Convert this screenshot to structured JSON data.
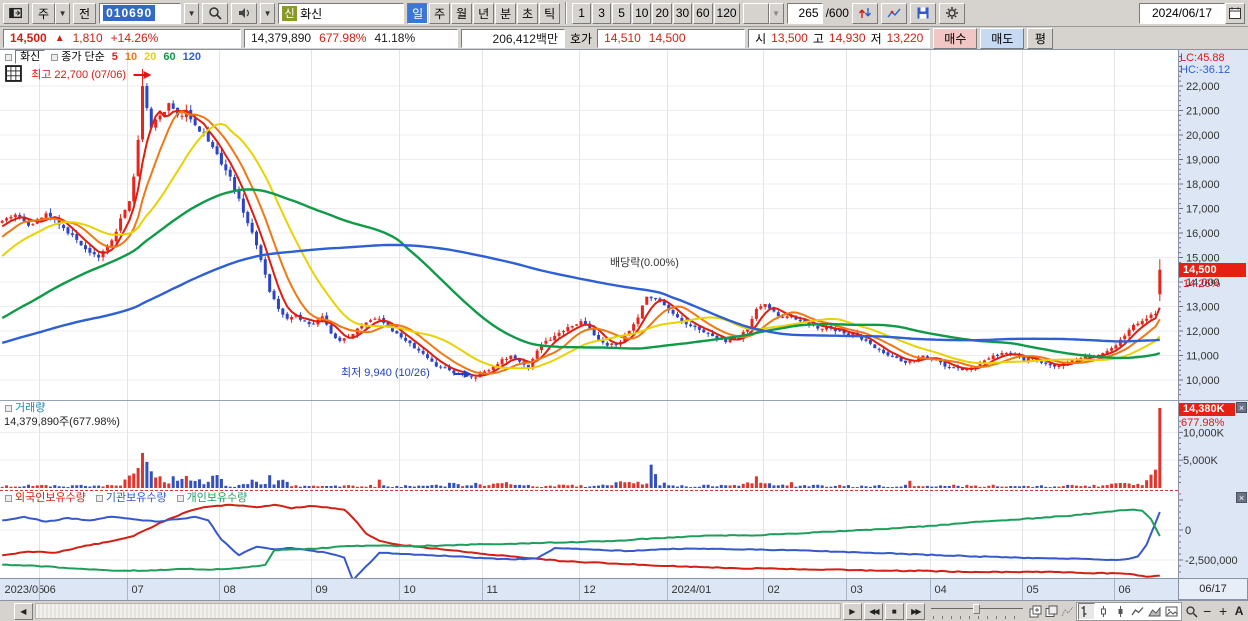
{
  "toolbar": {
    "combo1": "주",
    "prev_btn": "전",
    "code": "010690",
    "stock_badge": "신",
    "stock_name": "화신",
    "periods": [
      "일",
      "주",
      "월",
      "년",
      "분",
      "초",
      "틱"
    ],
    "active_period": "일",
    "minutes": [
      "1",
      "3",
      "5",
      "10",
      "20",
      "30",
      "60",
      "120"
    ],
    "bar_count": "265",
    "bar_total": "/600",
    "date": "2024/06/17"
  },
  "info": {
    "price": "14,500",
    "arrow": "▲",
    "change": "1,810",
    "change_pct": "+14.26%",
    "volume": "14,379,890",
    "vol_rate": "677.98%",
    "turnover": "41.18%",
    "value": "206,412백만",
    "hoga_label": "호가",
    "ask": "14,510",
    "bid": "14,500",
    "open_label": "시",
    "open": "13,500",
    "high_label": "고",
    "high": "14,930",
    "low_label": "저",
    "low": "13,220",
    "buy_btn": "매수",
    "sell_btn": "매도",
    "avg_btn": "평"
  },
  "bottom": {
    "font_label": "A"
  },
  "chart_data": {
    "type": "candlestick",
    "symbol": "화신",
    "code": "010690",
    "timeframe": "일",
    "bars_visible": 265,
    "legend_title": "화신",
    "legend_ma": "종가 단순",
    "lc_label": "LC:45.88",
    "hc_label": "HC:-36.12",
    "price_axis": {
      "min": 10000,
      "max": 22000,
      "step": 1000
    },
    "current_price_label": "14,500",
    "current_pct": "14.26%",
    "last_bar": {
      "open": 13500,
      "high": 14930,
      "low": 13220,
      "close": 14500,
      "volume_k": 14380
    },
    "high_marker": {
      "text": "최고 22,700 (07/06)",
      "index": 32,
      "price": 22700
    },
    "low_marker": {
      "text": "최저 9,940 (10/26)",
      "index": 108,
      "price": 9940
    },
    "event_marker": {
      "text": "배당락(0.00%)",
      "index": 148
    },
    "x_axis_end_label": "06/17",
    "month_starts": [
      {
        "label": "2023/05",
        "i": 0
      },
      {
        "label": "06",
        "i": 9
      },
      {
        "label": "07",
        "i": 29
      },
      {
        "label": "08",
        "i": 50
      },
      {
        "label": "09",
        "i": 71
      },
      {
        "label": "10",
        "i": 91
      },
      {
        "label": "11",
        "i": 110
      },
      {
        "label": "12",
        "i": 132
      },
      {
        "label": "2024/01",
        "i": 152
      },
      {
        "label": "02",
        "i": 174
      },
      {
        "label": "03",
        "i": 193
      },
      {
        "label": "04",
        "i": 212
      },
      {
        "label": "05",
        "i": 233
      },
      {
        "label": "06",
        "i": 254
      }
    ],
    "close_anchors": [
      [
        0,
        16500
      ],
      [
        3,
        16750
      ],
      [
        6,
        16300
      ],
      [
        10,
        16800
      ],
      [
        14,
        16200
      ],
      [
        18,
        15500
      ],
      [
        22,
        15000
      ],
      [
        25,
        15700
      ],
      [
        27,
        16600
      ],
      [
        29,
        17300
      ],
      [
        30,
        18300
      ],
      [
        31,
        19800
      ],
      [
        32,
        22000
      ],
      [
        33,
        21100
      ],
      [
        34,
        20300
      ],
      [
        36,
        20800
      ],
      [
        38,
        21300
      ],
      [
        40,
        20800
      ],
      [
        42,
        21000
      ],
      [
        44,
        20400
      ],
      [
        46,
        20100
      ],
      [
        48,
        19500
      ],
      [
        50,
        18800
      ],
      [
        52,
        18300
      ],
      [
        54,
        17400
      ],
      [
        56,
        16400
      ],
      [
        58,
        15500
      ],
      [
        60,
        14300
      ],
      [
        61,
        13600
      ],
      [
        63,
        12900
      ],
      [
        65,
        12500
      ],
      [
        67,
        12650
      ],
      [
        69,
        12400
      ],
      [
        71,
        12300
      ],
      [
        73,
        12600
      ],
      [
        75,
        11900
      ],
      [
        77,
        11600
      ],
      [
        79,
        11750
      ],
      [
        81,
        12100
      ],
      [
        83,
        12350
      ],
      [
        86,
        12500
      ],
      [
        88,
        12150
      ],
      [
        90,
        11900
      ],
      [
        93,
        11500
      ],
      [
        95,
        11200
      ],
      [
        97,
        10900
      ],
      [
        99,
        10550
      ],
      [
        102,
        10400
      ],
      [
        104,
        10250
      ],
      [
        106,
        10150
      ],
      [
        108,
        10100
      ],
      [
        110,
        10350
      ],
      [
        112,
        10550
      ],
      [
        114,
        10850
      ],
      [
        116,
        11000
      ],
      [
        118,
        10750
      ],
      [
        120,
        10500
      ],
      [
        122,
        11200
      ],
      [
        124,
        11600
      ],
      [
        126,
        11800
      ],
      [
        128,
        12000
      ],
      [
        130,
        12200
      ],
      [
        132,
        12400
      ],
      [
        134,
        12100
      ],
      [
        136,
        11650
      ],
      [
        138,
        11400
      ],
      [
        141,
        11550
      ],
      [
        143,
        12000
      ],
      [
        145,
        12550
      ],
      [
        147,
        13400
      ],
      [
        149,
        13300
      ],
      [
        151,
        13050
      ],
      [
        153,
        12700
      ],
      [
        155,
        12400
      ],
      [
        157,
        12200
      ],
      [
        159,
        12050
      ],
      [
        161,
        11900
      ],
      [
        163,
        11700
      ],
      [
        165,
        11550
      ],
      [
        168,
        11700
      ],
      [
        170,
        12100
      ],
      [
        172,
        12900
      ],
      [
        174,
        13100
      ],
      [
        176,
        12800
      ],
      [
        178,
        12550
      ],
      [
        180,
        12600
      ],
      [
        182,
        12400
      ],
      [
        184,
        12250
      ],
      [
        186,
        12100
      ],
      [
        188,
        12200
      ],
      [
        190,
        12000
      ],
      [
        192,
        11900
      ],
      [
        195,
        11800
      ],
      [
        197,
        11600
      ],
      [
        199,
        11300
      ],
      [
        201,
        11100
      ],
      [
        204,
        10900
      ],
      [
        206,
        10700
      ],
      [
        208,
        10800
      ],
      [
        210,
        11000
      ],
      [
        213,
        10800
      ],
      [
        215,
        10550
      ],
      [
        217,
        10500
      ],
      [
        219,
        10400
      ],
      [
        222,
        10550
      ],
      [
        224,
        10800
      ],
      [
        226,
        11000
      ],
      [
        228,
        11100
      ],
      [
        231,
        11000
      ],
      [
        233,
        10800
      ],
      [
        235,
        10900
      ],
      [
        237,
        10700
      ],
      [
        240,
        10550
      ],
      [
        242,
        10700
      ],
      [
        244,
        10800
      ],
      [
        246,
        10900
      ],
      [
        249,
        11000
      ],
      [
        251,
        11100
      ],
      [
        253,
        11300
      ],
      [
        255,
        11650
      ],
      [
        257,
        12050
      ],
      [
        259,
        12300
      ],
      [
        261,
        12500
      ],
      [
        263,
        12690
      ],
      [
        264,
        14500
      ]
    ],
    "noise": 0.012,
    "ma_series": [
      {
        "period": 5,
        "color": "#e11d10"
      },
      {
        "period": 10,
        "color": "#f07814"
      },
      {
        "period": 20,
        "color": "#e8d200"
      },
      {
        "period": 60,
        "color": "#0f9a48"
      },
      {
        "period": 120,
        "color": "#2e5fd4"
      }
    ],
    "volume": {
      "legend": "거래량",
      "detail": "14,379,890주(677.98%)",
      "current_label": "14,380K",
      "current_pct": "677.98%",
      "ticks": [
        {
          "label": "10,000K",
          "v": 10000
        },
        {
          "label": "5,000K",
          "v": 5000
        }
      ],
      "spikes": [
        [
          30,
          2600
        ],
        [
          31,
          3600
        ],
        [
          32,
          6300
        ],
        [
          33,
          4700
        ],
        [
          34,
          3000
        ],
        [
          48,
          2200
        ],
        [
          61,
          2300
        ],
        [
          86,
          1500
        ],
        [
          148,
          4200
        ],
        [
          149,
          2500
        ],
        [
          172,
          2100
        ],
        [
          207,
          1300
        ],
        [
          255,
          900
        ],
        [
          261,
          1400
        ],
        [
          262,
          2400
        ],
        [
          263,
          3300
        ],
        [
          264,
          14380
        ]
      ],
      "regions": [
        [
          28,
          50,
          4
        ],
        [
          55,
          65,
          2.5
        ],
        [
          100,
          116,
          1.8
        ],
        [
          140,
          152,
          2
        ],
        [
          166,
          180,
          1.8
        ],
        [
          253,
          263,
          2
        ]
      ]
    },
    "holdings": {
      "series": [
        {
          "name": "외국인보유수량",
          "color": "#d22014",
          "anchors": [
            [
              0,
              -2.1
            ],
            [
              6,
              -1.8
            ],
            [
              12,
              -1.9
            ],
            [
              18,
              -1.4
            ],
            [
              24,
              -1.0
            ],
            [
              30,
              -0.5
            ],
            [
              36,
              0.6
            ],
            [
              42,
              1.5
            ],
            [
              46,
              1.9
            ],
            [
              52,
              2.1
            ],
            [
              58,
              1.9
            ],
            [
              62,
              2.1
            ],
            [
              66,
              1.8
            ],
            [
              70,
              2.0
            ],
            [
              74,
              1.9
            ],
            [
              78,
              1.7
            ],
            [
              80,
              1.0
            ],
            [
              83,
              -0.3
            ],
            [
              86,
              -0.9
            ],
            [
              90,
              -1.2
            ],
            [
              95,
              -1.4
            ],
            [
              100,
              -1.6
            ],
            [
              105,
              -1.8
            ],
            [
              110,
              -2.0
            ],
            [
              116,
              -2.2
            ],
            [
              122,
              -2.4
            ],
            [
              128,
              -2.6
            ],
            [
              134,
              -2.7
            ],
            [
              140,
              -2.8
            ],
            [
              146,
              -2.9
            ],
            [
              152,
              -3.0
            ],
            [
              160,
              -3.1
            ],
            [
              168,
              -3.2
            ],
            [
              176,
              -3.2
            ],
            [
              184,
              -3.3
            ],
            [
              192,
              -3.3
            ],
            [
              200,
              -3.4
            ],
            [
              210,
              -3.4
            ],
            [
              220,
              -3.5
            ],
            [
              230,
              -3.5
            ],
            [
              240,
              -3.5
            ],
            [
              248,
              -3.6
            ],
            [
              254,
              -3.6
            ],
            [
              258,
              -3.7
            ],
            [
              261,
              -3.9
            ],
            [
              264,
              -3.8
            ]
          ]
        },
        {
          "name": "기관보유수량",
          "color": "#3558cc",
          "anchors": [
            [
              0,
              0.8
            ],
            [
              5,
              1.1
            ],
            [
              10,
              0.7
            ],
            [
              15,
              1.0
            ],
            [
              20,
              0.8
            ],
            [
              25,
              1.1
            ],
            [
              30,
              0.9
            ],
            [
              35,
              0.7
            ],
            [
              40,
              0.9
            ],
            [
              44,
              1.1
            ],
            [
              47,
              0.8
            ],
            [
              50,
              -0.8
            ],
            [
              54,
              -2.1
            ],
            [
              58,
              -1.4
            ],
            [
              62,
              -1.6
            ],
            [
              66,
              -1.5
            ],
            [
              70,
              -1.7
            ],
            [
              74,
              -1.9
            ],
            [
              78,
              -2.3
            ],
            [
              80,
              -4.2
            ],
            [
              82,
              -3.4
            ],
            [
              86,
              -1.9
            ],
            [
              92,
              -2.0
            ],
            [
              98,
              -2.1
            ],
            [
              104,
              -2.2
            ],
            [
              110,
              -2.35
            ],
            [
              116,
              -2.45
            ],
            [
              122,
              -2.35
            ],
            [
              126,
              -1.5
            ],
            [
              132,
              -1.6
            ],
            [
              138,
              -1.7
            ],
            [
              144,
              -1.75
            ],
            [
              150,
              -1.6
            ],
            [
              158,
              -1.55
            ],
            [
              166,
              -1.6
            ],
            [
              174,
              -1.65
            ],
            [
              182,
              -1.7
            ],
            [
              190,
              -1.8
            ],
            [
              198,
              -1.9
            ],
            [
              206,
              -2.0
            ],
            [
              214,
              -2.1
            ],
            [
              222,
              -2.2
            ],
            [
              230,
              -2.3
            ],
            [
              238,
              -2.35
            ],
            [
              246,
              -2.4
            ],
            [
              252,
              -2.5
            ],
            [
              256,
              -2.45
            ],
            [
              259,
              -2.2
            ],
            [
              261,
              -1.2
            ],
            [
              264,
              1.5
            ]
          ]
        },
        {
          "name": "개인보유수량",
          "color": "#1e9e5c",
          "anchors": [
            [
              0,
              -2.9
            ],
            [
              8,
              -3.0
            ],
            [
              16,
              -3.2
            ],
            [
              24,
              -3.35
            ],
            [
              32,
              -3.4
            ],
            [
              40,
              -3.25
            ],
            [
              48,
              -3.3
            ],
            [
              56,
              -3.1
            ],
            [
              60,
              -2.9
            ],
            [
              62,
              -1.7
            ],
            [
              66,
              -1.6
            ],
            [
              72,
              -1.55
            ],
            [
              78,
              -1.35
            ],
            [
              84,
              -1.3
            ],
            [
              92,
              -1.35
            ],
            [
              100,
              -1.3
            ],
            [
              108,
              -1.2
            ],
            [
              116,
              -1.15
            ],
            [
              124,
              -1.05
            ],
            [
              132,
              -1.0
            ],
            [
              140,
              -0.9
            ],
            [
              148,
              -0.7
            ],
            [
              156,
              -0.55
            ],
            [
              164,
              -0.45
            ],
            [
              172,
              -0.45
            ],
            [
              180,
              -0.3
            ],
            [
              188,
              -0.15
            ],
            [
              196,
              0.0
            ],
            [
              204,
              0.15
            ],
            [
              212,
              0.35
            ],
            [
              220,
              0.6
            ],
            [
              228,
              0.8
            ],
            [
              236,
              1.0
            ],
            [
              244,
              1.2
            ],
            [
              250,
              1.45
            ],
            [
              254,
              1.6
            ],
            [
              258,
              1.7
            ],
            [
              260,
              1.6
            ],
            [
              262,
              0.9
            ],
            [
              264,
              -0.5
            ]
          ]
        }
      ],
      "ticks": [
        {
          "label": "0",
          "v": 0
        },
        {
          "label": "-2,500,000",
          "v": -2.5
        }
      ]
    }
  }
}
